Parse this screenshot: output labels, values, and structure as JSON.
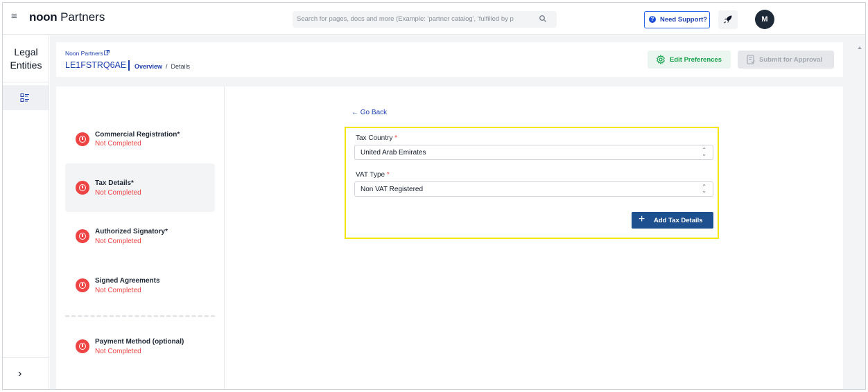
{
  "topbar": {
    "brand_bold": "noon",
    "brand_rest": " Partners",
    "search_placeholder": "Search for pages, docs and more (Example: 'partner catalog', 'fulfilled by p",
    "support_icon": "?",
    "support_label": "Need Support?",
    "avatar_initial": "M"
  },
  "rail": {
    "title_line1": "Legal",
    "title_line2": "Entities",
    "expand_icon": "›"
  },
  "header": {
    "parent_link": "Noon Partners",
    "entity_id": "LE1FSTRQ6AE",
    "crumb_overview": "Overview",
    "crumb_sep": "/",
    "crumb_current": "Details",
    "edit_label": "Edit Preferences",
    "submit_label": "Submit for Approval"
  },
  "steps": [
    {
      "title": "Commercial Registration*",
      "status": "Not Completed"
    },
    {
      "title": "Tax Details*",
      "status": "Not Completed"
    },
    {
      "title": "Authorized Signatory*",
      "status": "Not Completed"
    },
    {
      "title": "Signed Agreements",
      "status": "Not Completed"
    },
    {
      "title": "Payment Method (optional)",
      "status": "Not Completed"
    }
  ],
  "form": {
    "go_back": "← Go Back",
    "tax_country_label": "Tax Country",
    "tax_country_value": "United Arab Emirates",
    "vat_type_label": "VAT Type",
    "vat_type_value": "Non VAT Registered",
    "required_mark": "*",
    "add_label": "Add Tax Details"
  },
  "colors": {
    "primary": "#1e40af",
    "button": "#1e4f8e",
    "error": "#ef4444",
    "success": "#16a34a",
    "highlight": "#f5e60a"
  }
}
